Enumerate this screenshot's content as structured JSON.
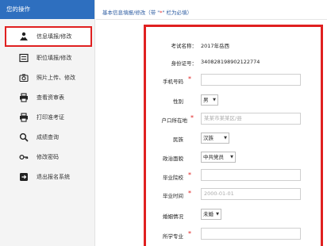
{
  "sidebar": {
    "header": "您的操作",
    "items": [
      {
        "label": "信息填报/修改",
        "icon": "person-icon"
      },
      {
        "label": "职位填报/修改",
        "icon": "form-icon"
      },
      {
        "label": "照片上传、修改",
        "icon": "camera-icon"
      },
      {
        "label": "查看资审表",
        "icon": "printer-icon"
      },
      {
        "label": "打印准考证",
        "icon": "printer-icon"
      },
      {
        "label": "成绩查询",
        "icon": "search-icon"
      },
      {
        "label": "修改密码",
        "icon": "key-icon"
      },
      {
        "label": "退出报名系统",
        "icon": "exit-icon"
      }
    ]
  },
  "breadcrumb": {
    "text_before": "基本信息填报/修改（带 \"",
    "required_mark": "*",
    "text_after": "\" 栏为必填）"
  },
  "form": {
    "exam_name_label": "考试名称：",
    "exam_name_value": "2017年岳西",
    "id_label": "身份证号：",
    "id_value": "340828198902122774",
    "phone_label": "手机号码",
    "phone_value": "",
    "gender_label": "性别",
    "gender_value": "男",
    "hukou_label": "户口所在地",
    "hukou_placeholder": "某某市某某区/县",
    "ethnicity_label": "民族",
    "ethnicity_value": "汉族",
    "political_label": "政治面貌",
    "political_value": "中共党员",
    "school_label": "毕业院校",
    "school_value": "",
    "grad_time_label": "毕业时间",
    "grad_time_placeholder": "2000-01-01",
    "marital_label": "婚姻情况",
    "marital_value": "未婚",
    "major_label": "所学专业",
    "major_value": "",
    "required_mark": "*"
  },
  "colors": {
    "accent": "#2e6fbf",
    "highlight": "#e02020"
  }
}
